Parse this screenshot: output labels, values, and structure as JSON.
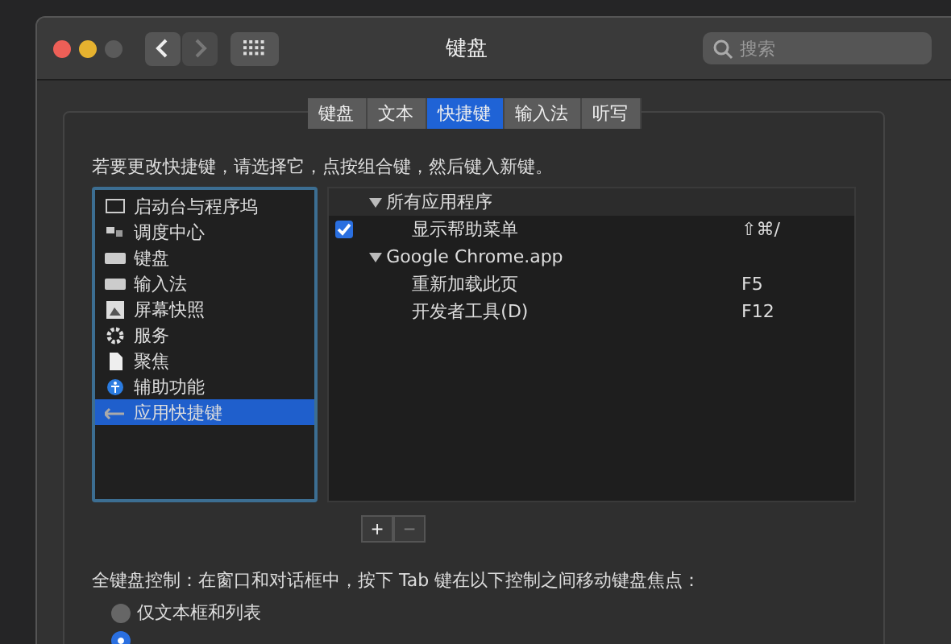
{
  "window": {
    "title": "键盘",
    "search": {
      "placeholder": "搜索"
    },
    "nav": {
      "back_disabled": false,
      "forward_disabled": true
    }
  },
  "tabs": [
    {
      "label": "键盘",
      "selected": false
    },
    {
      "label": "文本",
      "selected": false
    },
    {
      "label": "快捷键",
      "selected": true
    },
    {
      "label": "输入法",
      "selected": false
    },
    {
      "label": "听写",
      "selected": false
    }
  ],
  "instruction": "若要更改快捷键，请选择它，点按组合键，然后键入新键。",
  "categories": [
    {
      "label": "启动台与程序坞",
      "selected": false
    },
    {
      "label": "调度中心",
      "selected": false
    },
    {
      "label": "键盘",
      "selected": false
    },
    {
      "label": "输入法",
      "selected": false
    },
    {
      "label": "屏幕快照",
      "selected": false
    },
    {
      "label": "服务",
      "selected": false
    },
    {
      "label": "聚焦",
      "selected": false
    },
    {
      "label": "辅助功能",
      "selected": false
    },
    {
      "label": "应用快捷键",
      "selected": true
    }
  ],
  "shortcuts": [
    {
      "label": "所有应用程序",
      "expanded": true,
      "children": [
        {
          "label": "显示帮助菜单",
          "shortcut": "⇧⌘/",
          "checked": true
        }
      ]
    },
    {
      "label": "Google Chrome.app",
      "expanded": true,
      "children": [
        {
          "label": "重新加载此页",
          "shortcut": "F5"
        },
        {
          "label": "开发者工具(D)",
          "shortcut": "F12"
        }
      ]
    }
  ],
  "list_buttons": [
    "+",
    "−"
  ],
  "keyboard_control": {
    "label": "全键盘控制：在窗口和对话框中，按下 Tab 键在以下控制之间移动键盘焦点：",
    "options": [
      {
        "label": "仅文本框和列表",
        "selected": false
      },
      {
        "selected": true
      }
    ]
  }
}
